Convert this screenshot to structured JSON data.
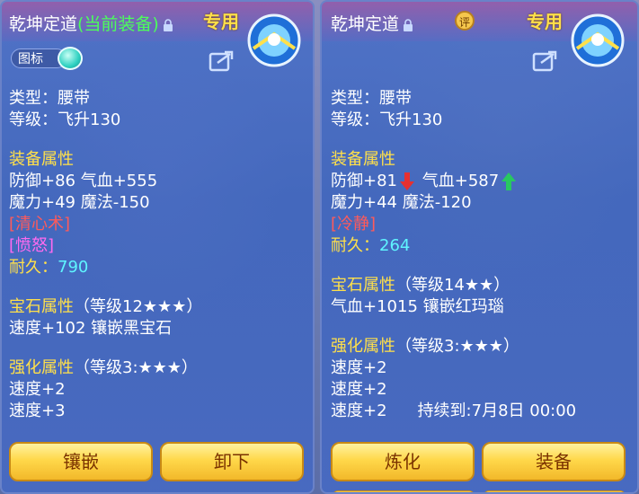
{
  "left_panel": {
    "name": "乾坤定道",
    "current_equip_tag": "(当前装备)",
    "exclusive_label": "专用",
    "icon_toggle_label": "图标",
    "type_line": "类型：腰带",
    "level_line": "等级：飞升130",
    "attr_heading": "装备属性",
    "attr_line1": "防御+86 气血+555",
    "attr_line2": "魔力+49 魔法-150",
    "skill1": "[清心术]",
    "skill2": "[愤怒]",
    "durability_label": "耐久：",
    "durability_value": "790",
    "gem_heading": "宝石属性",
    "gem_level": "（等级12★★★）",
    "gem_line": "速度+102 镶嵌黑宝石",
    "strengthen_heading": "强化属性",
    "strengthen_level": "（等级3:★★★）",
    "strengthen_line1": "速度+2",
    "strengthen_line2": "速度+3",
    "btn_inlay": "镶嵌",
    "btn_unequip": "卸下"
  },
  "right_panel": {
    "name": "乾坤定道",
    "eval_badge": "评",
    "exclusive_label": "专用",
    "type_line": "类型：腰带",
    "level_line": "等级：飞升130",
    "attr_heading": "装备属性",
    "defense": "防御+81",
    "hp": "气血+587",
    "attr_line2": "魔力+44 魔法-120",
    "skill1": "[冷静]",
    "durability_label": "耐久：",
    "durability_value": "264",
    "gem_heading": "宝石属性",
    "gem_level": "（等级14★★）",
    "gem_line": "气血+1015 镶嵌红玛瑙",
    "strengthen_heading": "强化属性",
    "strengthen_level": "（等级3:★★★）",
    "strengthen_line1": "速度+2",
    "strengthen_line2": "速度+2",
    "strengthen_line3": "速度+2",
    "duration": "持续到:7月8日 00:00",
    "btn_refine": "炼化",
    "btn_equip": "装备"
  },
  "colors": {
    "heading": "#ffe04a",
    "current_equip": "#4cff5a",
    "skill_red": "#ff5a5a",
    "skill_purple": "#ff6af0",
    "durability": "#5ff5ff",
    "stat_down": "#e63030",
    "stat_up": "#28c860"
  }
}
